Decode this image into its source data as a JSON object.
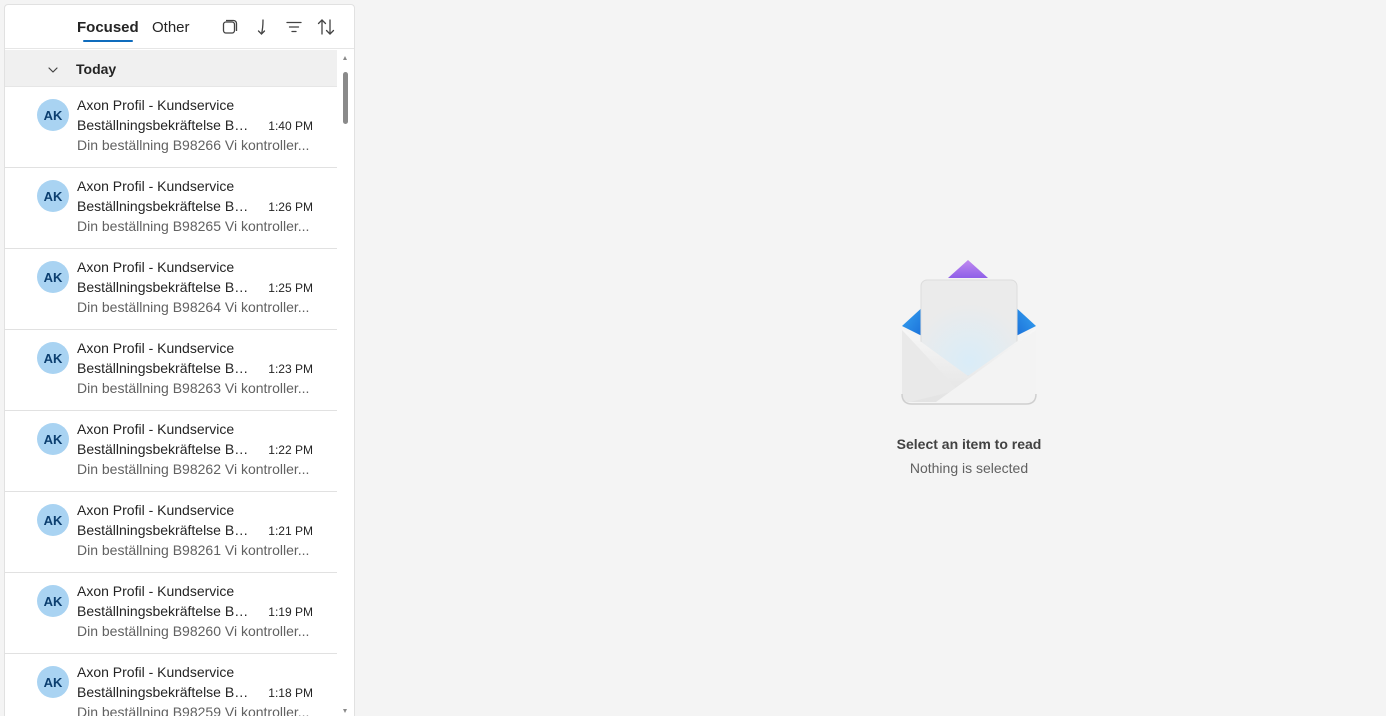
{
  "tabs": [
    {
      "label": "Focused",
      "active": true
    },
    {
      "label": "Other",
      "active": false
    }
  ],
  "toolbar": {
    "icons": [
      "select-mode-icon",
      "jump-down-icon",
      "filter-icon",
      "sort-icon"
    ]
  },
  "group": {
    "label": "Today",
    "icon": "chevron-down-icon"
  },
  "messages": [
    {
      "avatar": "AK",
      "sender": "Axon Profil - Kundservice",
      "subject": "Beställningsbekräftelse B9...",
      "time": "1:40 PM",
      "preview": "Din beställning B98266 Vi kontroller..."
    },
    {
      "avatar": "AK",
      "sender": "Axon Profil - Kundservice",
      "subject": "Beställningsbekräftelse B9...",
      "time": "1:26 PM",
      "preview": "Din beställning B98265 Vi kontroller..."
    },
    {
      "avatar": "AK",
      "sender": "Axon Profil - Kundservice",
      "subject": "Beställningsbekräftelse B9...",
      "time": "1:25 PM",
      "preview": "Din beställning B98264 Vi kontroller..."
    },
    {
      "avatar": "AK",
      "sender": "Axon Profil - Kundservice",
      "subject": "Beställningsbekräftelse B9...",
      "time": "1:23 PM",
      "preview": "Din beställning B98263 Vi kontroller..."
    },
    {
      "avatar": "AK",
      "sender": "Axon Profil - Kundservice",
      "subject": "Beställningsbekräftelse B9...",
      "time": "1:22 PM",
      "preview": "Din beställning B98262 Vi kontroller..."
    },
    {
      "avatar": "AK",
      "sender": "Axon Profil - Kundservice",
      "subject": "Beställningsbekräftelse B9...",
      "time": "1:21 PM",
      "preview": "Din beställning B98261 Vi kontroller..."
    },
    {
      "avatar": "AK",
      "sender": "Axon Profil - Kundservice",
      "subject": "Beställningsbekräftelse B9...",
      "time": "1:19 PM",
      "preview": "Din beställning B98260 Vi kontroller..."
    },
    {
      "avatar": "AK",
      "sender": "Axon Profil - Kundservice",
      "subject": "Beställningsbekräftelse B9...",
      "time": "1:18 PM",
      "preview": "Din beställning B98259 Vi kontroller..."
    }
  ],
  "reading_pane": {
    "title": "Select an item to read",
    "subtitle": "Nothing is selected",
    "icon": "open-envelope-icon"
  },
  "colors": {
    "accent": "#0f6cbd",
    "avatar_bg": "#a9d3f2",
    "avatar_text": "#0b3e6f",
    "background": "#f4f4f4"
  }
}
